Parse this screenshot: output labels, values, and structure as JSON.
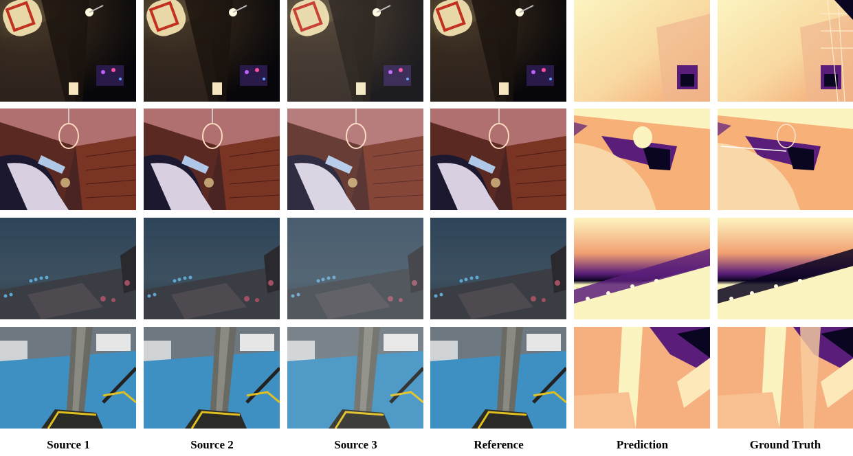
{
  "figure": {
    "columns": [
      "Source 1",
      "Source 2",
      "Source 3",
      "Reference",
      "Prediction",
      "Ground Truth"
    ],
    "rows": [
      {
        "scene": "night alley with paper lantern and street lamp"
      },
      {
        "scene": "interior with wooden ceiling, hanging wire lamp and vintage car"
      },
      {
        "scene": "underwater scene with fish school and rocky seabed"
      },
      {
        "scene": "industrial hall with blue floor, steel pillar and yellow railing"
      }
    ],
    "tile_types": [
      "rgb",
      "rgb",
      "rgb",
      "rgb",
      "depth",
      "depth"
    ],
    "colors": {
      "depth_near": "#fcf4c0",
      "depth_mid": "#f4a070",
      "depth_far": "#5a1e7a",
      "depth_deep": "#0a0520"
    }
  }
}
